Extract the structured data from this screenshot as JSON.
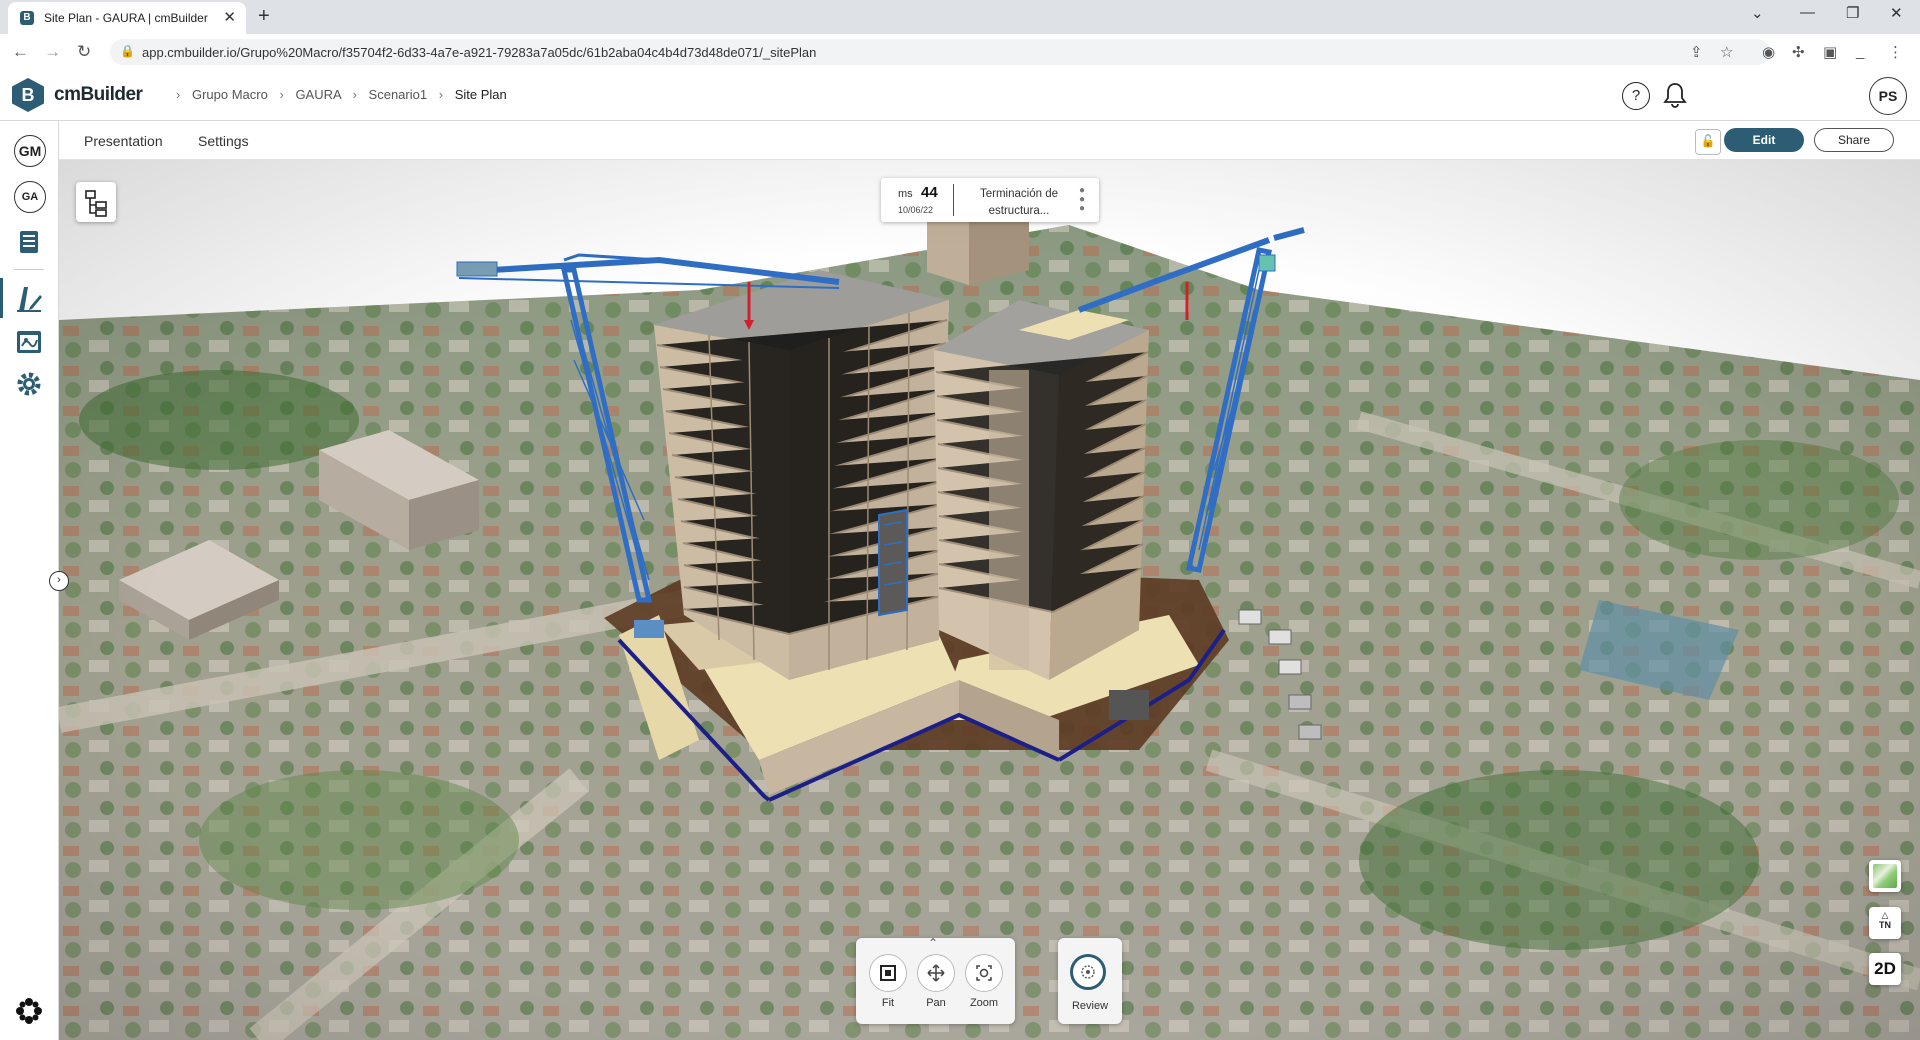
{
  "browser": {
    "tab_title": "Site Plan - GAURA | cmBuilder",
    "tab_favicon": "B",
    "url": "app.cmbuilder.io/Grupo%20Macro/f35704f2-6d33-4a7e-a921-79283a7a05dc/61b2aba04c4b4d73d48de071/_sitePlan"
  },
  "header": {
    "logo_letter": "B",
    "logo_text": "cmBuilder",
    "breadcrumbs": [
      "Grupo Macro",
      "GAURA",
      "Scenario1",
      "Site Plan"
    ],
    "avatar_initials": "PS"
  },
  "sidebar": {
    "org_initials": "GM",
    "project_initials": "GA",
    "items": [
      "book-icon",
      "site-plan-pencil-icon",
      "calendar-board-icon",
      "gear-icon"
    ]
  },
  "subheader": {
    "tabs": [
      "Presentation",
      "Settings"
    ],
    "edit_label": "Edit",
    "share_label": "Share"
  },
  "milestone": {
    "prefix": "ms",
    "number": "44",
    "date": "10/06/22",
    "description": "Terminación de estructura..."
  },
  "toolbar": {
    "fit": "Fit",
    "pan": "Pan",
    "zoom": "Zoom",
    "review": "Review"
  },
  "right_controls": {
    "north_label": "TN",
    "view_mode": "2D"
  },
  "colors": {
    "brand": "#2c5d74",
    "crane_blue": "#2f6ec4",
    "building_tan": "#c8b8a3",
    "slab_cream": "#ede0b2"
  }
}
